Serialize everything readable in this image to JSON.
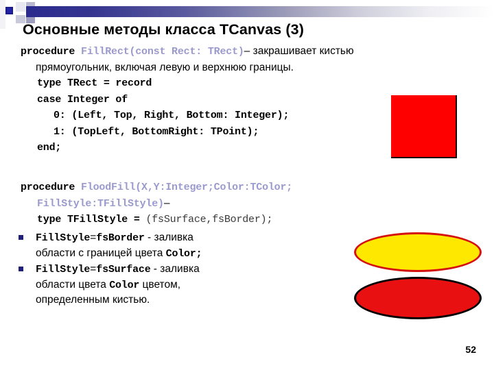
{
  "slide": {
    "title": "Основные методы класса TCanvas (3)",
    "page_number": "52",
    "accent_color": "#2b2b8f",
    "bullet_color": "#1f1f7a",
    "code_highlight_color": "#9a9ace"
  },
  "block1": {
    "line0_keyword": "procedure",
    "line0_signature": "FillRect(const Rect: TRect)",
    "line0_desc": "– закрашивает кистью",
    "line1": "прямоугольник, включая левую и верхнюю границы.",
    "line2": "type TRect = record",
    "line3": "case Integer of",
    "line4": "0: (Left, Top, Right, Bottom: Integer);",
    "line5": "1: (TopLeft, BottomRight: TPoint);",
    "line6": "end;"
  },
  "block2": {
    "line0_keyword": "procedure",
    "line0_signature": "FloodFill(X,Y:Integer;Color:TColor;",
    "line1_signature": "FillStyle:TFillStyle)",
    "line1_dash": "–",
    "line2_a": "type TFillStyle = ",
    "line2_b": "(fsSurface,fsBorder);"
  },
  "bullets": [
    {
      "mark": "square-bullet",
      "line1_code_a": "FillStyle",
      "line1_eq": "=",
      "line1_code_b": "fsBorder",
      "line1_sep": " - ",
      "line1_text": "заливка",
      "line2_text": "области с границей цвета ",
      "line2_code": "Color;"
    },
    {
      "mark": "square-bullet",
      "line1_code_a": "FillStyle",
      "line1_eq": "=",
      "line1_code_b": "fsSurface",
      "line1_sep": " - ",
      "line1_text": "заливка",
      "line2_text": "области цвета ",
      "line2_code": "Color",
      "line2_text_b": " цветом,",
      "line3_text": "определенным кистью."
    }
  ],
  "shapes": {
    "rectangle": {
      "name": "red-rectangle",
      "fill": "#ff0000",
      "border": "#1a0000"
    },
    "ellipse_yellow": {
      "name": "yellow-ellipse",
      "fill": "#ffe800",
      "border": "#d41010"
    },
    "ellipse_red": {
      "name": "red-ellipse",
      "fill": "#e81010",
      "border": "#000000"
    }
  }
}
